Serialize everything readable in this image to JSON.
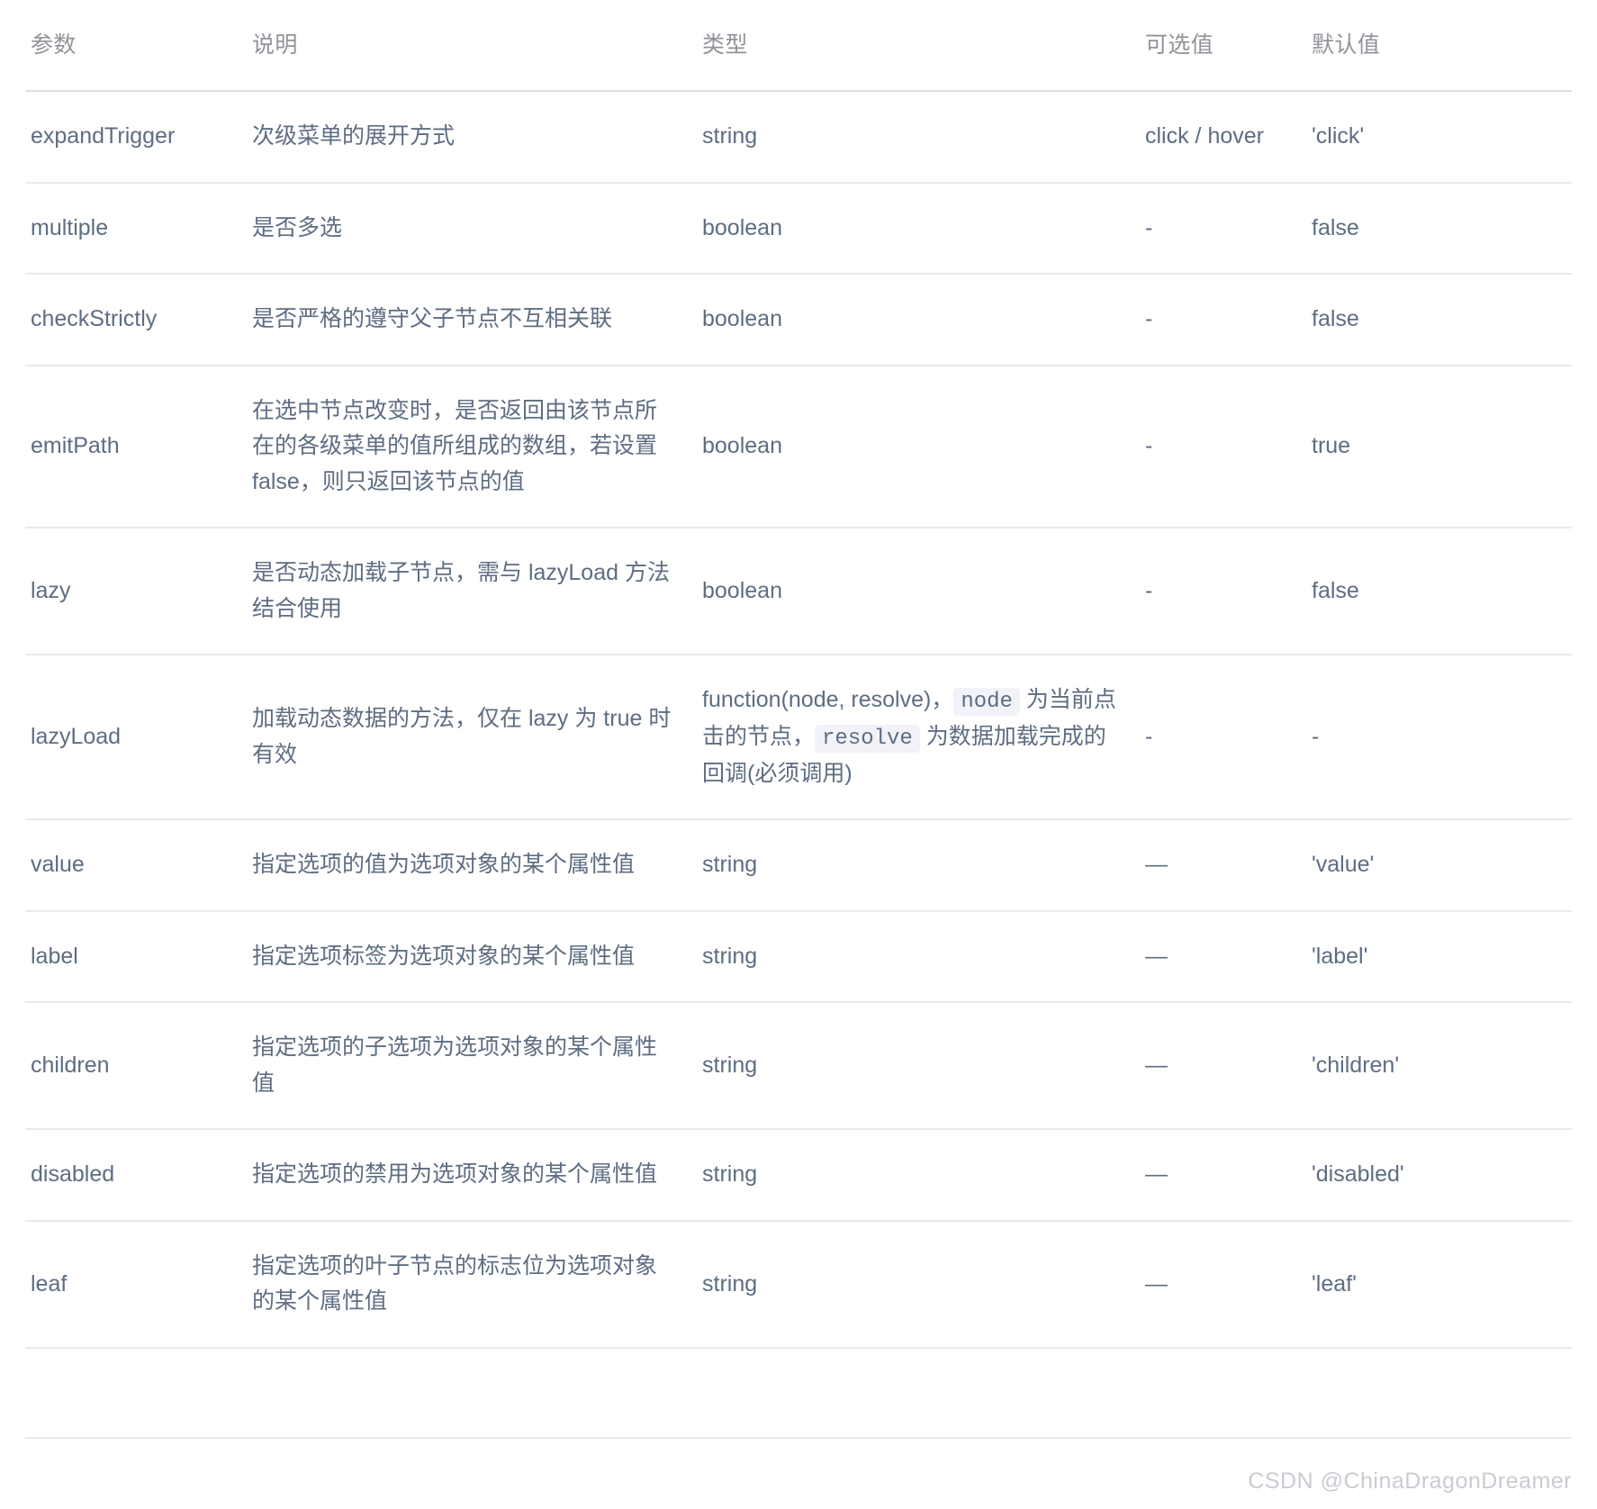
{
  "table": {
    "columns": [
      {
        "key": "param",
        "label": "参数"
      },
      {
        "key": "desc",
        "label": "说明"
      },
      {
        "key": "type",
        "label": "类型"
      },
      {
        "key": "options",
        "label": "可选值"
      },
      {
        "key": "default",
        "label": "默认值"
      }
    ],
    "rows": [
      {
        "param": "expandTrigger",
        "desc": "次级菜单的展开方式",
        "type": "string",
        "options": "click / hover",
        "default": "'click'"
      },
      {
        "param": "multiple",
        "desc": "是否多选",
        "type": "boolean",
        "options": "-",
        "default": "false"
      },
      {
        "param": "checkStrictly",
        "desc": "是否严格的遵守父子节点不互相关联",
        "type": "boolean",
        "options": "-",
        "default": "false"
      },
      {
        "param": "emitPath",
        "desc": "在选中节点改变时，是否返回由该节点所在的各级菜单的值所组成的数组，若设置 false，则只返回该节点的值",
        "type": "boolean",
        "options": "-",
        "default": "true"
      },
      {
        "param": "lazy",
        "desc": "是否动态加载子节点，需与 lazyLoad 方法结合使用",
        "type": "boolean",
        "options": "-",
        "default": "false"
      },
      {
        "param": "lazyLoad",
        "desc": "加载动态数据的方法，仅在 lazy 为 true 时有效",
        "type_parts": [
          {
            "kind": "text",
            "text": "function(node, resolve)，"
          },
          {
            "kind": "code",
            "text": "node"
          },
          {
            "kind": "text",
            "text": " 为当前点击的节点，"
          },
          {
            "kind": "code",
            "text": "resolve"
          },
          {
            "kind": "text",
            "text": " 为数据加载完成的回调(必须调用)"
          }
        ],
        "type": "function(node, resolve)，node 为当前点击的节点，resolve 为数据加载完成的回调(必须调用)",
        "options": "-",
        "default": "-"
      },
      {
        "param": "value",
        "desc": "指定选项的值为选项对象的某个属性值",
        "type": "string",
        "options": "—",
        "default": "'value'"
      },
      {
        "param": "label",
        "desc": "指定选项标签为选项对象的某个属性值",
        "type": "string",
        "options": "—",
        "default": "'label'"
      },
      {
        "param": "children",
        "desc": "指定选项的子选项为选项对象的某个属性值",
        "type": "string",
        "options": "—",
        "default": "'children'"
      },
      {
        "param": "disabled",
        "desc": "指定选项的禁用为选项对象的某个属性值",
        "type": "string",
        "options": "—",
        "default": "'disabled'"
      },
      {
        "param": "leaf",
        "desc": "指定选项的叶子节点的标志位为选项对象的某个属性值",
        "type": "string",
        "options": "—",
        "default": "'leaf'"
      }
    ]
  },
  "watermark": {
    "text": "CSDN @ChinaDragonDreamer"
  },
  "colors": {
    "text": "#5e6d82",
    "header_text": "#909399",
    "row_border": "#e8eaee",
    "head_border": "#dcdfe6",
    "code_background": "#f1f3f8",
    "watermark": "#c9ccd2"
  }
}
